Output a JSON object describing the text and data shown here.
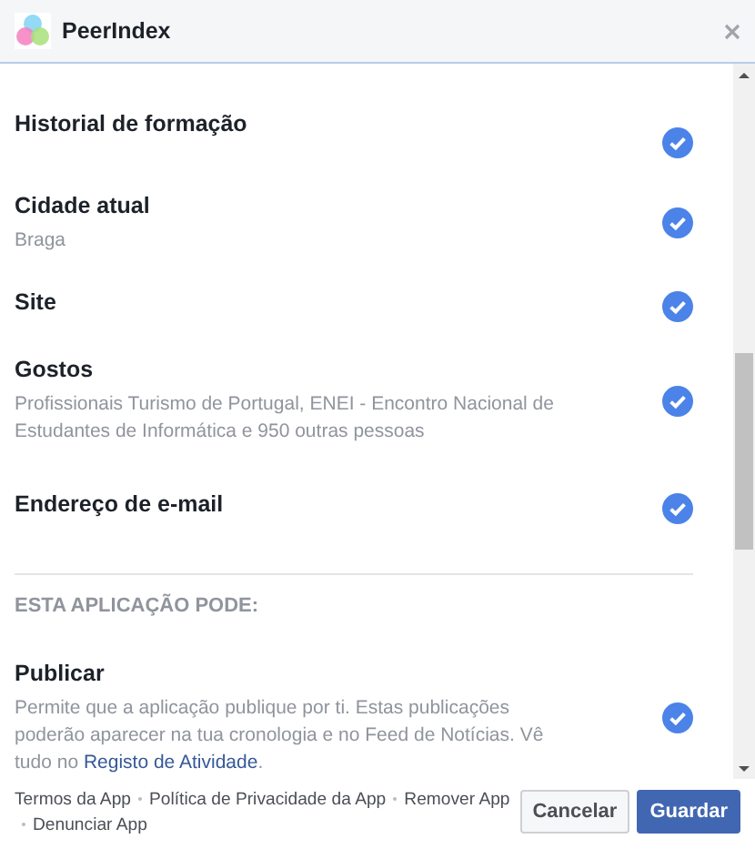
{
  "window": {
    "title": "PeerIndex"
  },
  "permissions": [
    {
      "title": "Historial de formação",
      "checked": true
    },
    {
      "title": "Cidade atual",
      "detail": "Braga",
      "checked": true
    },
    {
      "title": "Site",
      "checked": true
    },
    {
      "title": "Gostos",
      "detail": "Profissionais Turismo de Portugal, ENEI - Encontro Nacional de Estudantes de Informática e 950 outras pessoas",
      "checked": true
    },
    {
      "title": "Endereço de e-mail",
      "checked": true
    }
  ],
  "section": {
    "heading": "ESTA APLICAÇÃO PODE:",
    "permissions": [
      {
        "title": "Publicar",
        "detail": "Permite que a aplicação publique por ti. Estas publicações poderão aparecer na tua cronologia e no Feed de Notícias. Vê tudo no ",
        "link": "Registo de Atividade",
        "after": ".",
        "checked": true
      }
    ]
  },
  "footer_links": [
    "Termos da App",
    "Política de Privacidade da App",
    "Remover App",
    "Denunciar App"
  ],
  "buttons": [
    {
      "label": "Cancelar",
      "kind": "secondary"
    },
    {
      "label": "Guardar",
      "kind": "primary"
    }
  ]
}
